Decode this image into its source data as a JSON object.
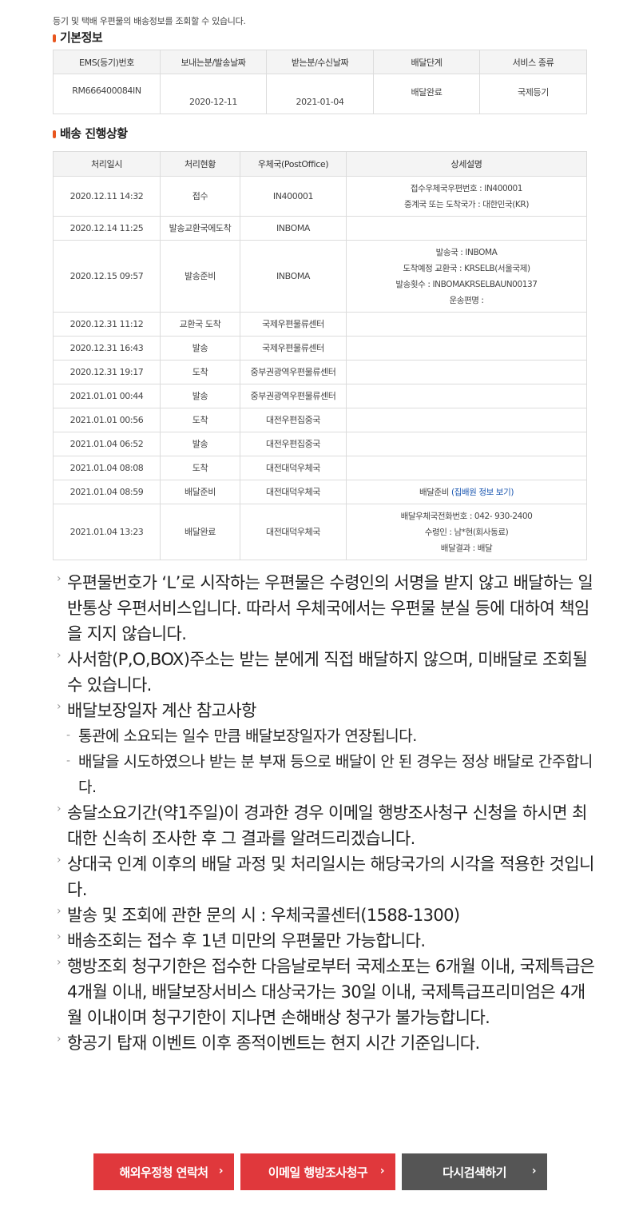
{
  "intro": "등기 및 택배 우편물의 배송정보를 조회할 수 있습니다.",
  "basic_info": {
    "title": "기본정보",
    "headers": [
      "EMS(등기)번호",
      "보내는분/발송날짜",
      "받는분/수신날짜",
      "배달단계",
      "서비스 종류"
    ],
    "row": [
      "RM666400084IN",
      "2020-12-11",
      "2021-01-04",
      "배달완료",
      "국제등기"
    ]
  },
  "progress": {
    "title": "배송 진행상황",
    "headers": [
      "처리일시",
      "처리현황",
      "우체국(PostOffice)",
      "상세설명"
    ],
    "rows": [
      {
        "datetime": "2020.12.11 14:32",
        "status": "접수",
        "office": "IN400001",
        "detail": [
          "접수우체국우편번호 : IN400001",
          "중계국 또는 도착국가 : 대한민국(KR)"
        ]
      },
      {
        "datetime": "2020.12.14 11:25",
        "status": "발송교환국에도착",
        "office": "INBOMA",
        "detail": []
      },
      {
        "datetime": "2020.12.15 09:57",
        "status": "발송준비",
        "office": "INBOMA",
        "detail": [
          "발송국 : INBOMA",
          "도착예정 교환국 : KRSELB(서울국제)",
          "발송횟수 : INBOMAKRSELBAUN00137",
          "운송편명 :"
        ]
      },
      {
        "datetime": "2020.12.31 11:12",
        "status": "교환국 도착",
        "office": "국제우편물류센터",
        "detail": []
      },
      {
        "datetime": "2020.12.31 16:43",
        "status": "발송",
        "office": "국제우편물류센터",
        "detail": []
      },
      {
        "datetime": "2020.12.31 19:17",
        "status": "도착",
        "office": "중부권광역우편물류센터",
        "detail": []
      },
      {
        "datetime": "2021.01.01 00:44",
        "status": "발송",
        "office": "중부권광역우편물류센터",
        "detail": []
      },
      {
        "datetime": "2021.01.01 00:56",
        "status": "도착",
        "office": "대전우편집중국",
        "detail": []
      },
      {
        "datetime": "2021.01.04 06:52",
        "status": "발송",
        "office": "대전우편집중국",
        "detail": []
      },
      {
        "datetime": "2021.01.04 08:08",
        "status": "도착",
        "office": "대전대덕우체국",
        "detail": []
      },
      {
        "datetime": "2021.01.04 08:59",
        "status": "배달준비",
        "office": "대전대덕우체국",
        "detail": [
          "배달준비 "
        ],
        "detail_link": "(집배원 정보 보기)"
      },
      {
        "datetime": "2021.01.04 13:23",
        "status": "배달완료",
        "office": "대전대덕우체국",
        "detail": [
          "배달우체국전화번호 : 042- 930-2400",
          "수령인 : 남*현(회사동료)",
          "배달결과 : 배달"
        ]
      }
    ]
  },
  "notices": [
    {
      "type": "main",
      "text": "우편물번호가 ‘L’로 시작하는 우편물은 수령인의 서명을 받지 않고 배달하는 일반통상 우편서비스입니다. 따라서 우체국에서는 우편물 분실 등에 대하여 책임을 지지 않습니다."
    },
    {
      "type": "main",
      "text": "사서함(P,O,BOX)주소는 받는 분에게 직접 배달하지 않으며, 미배달로 조회될 수 있습니다."
    },
    {
      "type": "main",
      "text": "배달보장일자 계산 참고사항"
    },
    {
      "type": "sub",
      "text": "통관에 소요되는 일수 만큼 배달보장일자가 연장됩니다."
    },
    {
      "type": "sub",
      "text": "배달을 시도하였으나 받는 분 부재 등으로 배달이 안 된 경우는 정상 배달로 간주합니다."
    },
    {
      "type": "main",
      "text": "송달소요기간(약1주일)이 경과한 경우 이메일 행방조사청구 신청을 하시면 최대한 신속히 조사한 후 그 결과를 알려드리겠습니다."
    },
    {
      "type": "main",
      "text": "상대국 인계 이후의 배달 과정 및 처리일시는 해당국가의 시각을 적용한 것입니다."
    },
    {
      "type": "main",
      "text": "발송 및 조회에 관한 문의 시 : 우체국콜센터(1588-1300)"
    },
    {
      "type": "main",
      "text": "배송조회는 접수 후 1년 미만의 우편물만 가능합니다."
    },
    {
      "type": "main",
      "text": "행방조회 청구기한은 접수한 다음날로부터 국제소포는 6개월 이내, 국제특급은 4개월 이내, 배달보장서비스 대상국가는 30일 이내, 국제특급프리미엄은 4개월 이내이며 청구기한이 지나면 손해배상 청구가 불가능합니다."
    },
    {
      "type": "main",
      "text": "항공기 탑재 이벤트 이후 종적이벤트는 현지 시간 기준입니다."
    }
  ],
  "buttons": {
    "overseas_contact": "해외우정청 연락처",
    "email_inquiry": "이메일 행방조사청구",
    "search_again": "다시검색하기",
    "chevron": "›"
  },
  "colors": {
    "accent_red": "#e0383c",
    "dark_button": "#555555",
    "bullet_orange": "#e8561f",
    "link_blue": "#1a56b0"
  }
}
